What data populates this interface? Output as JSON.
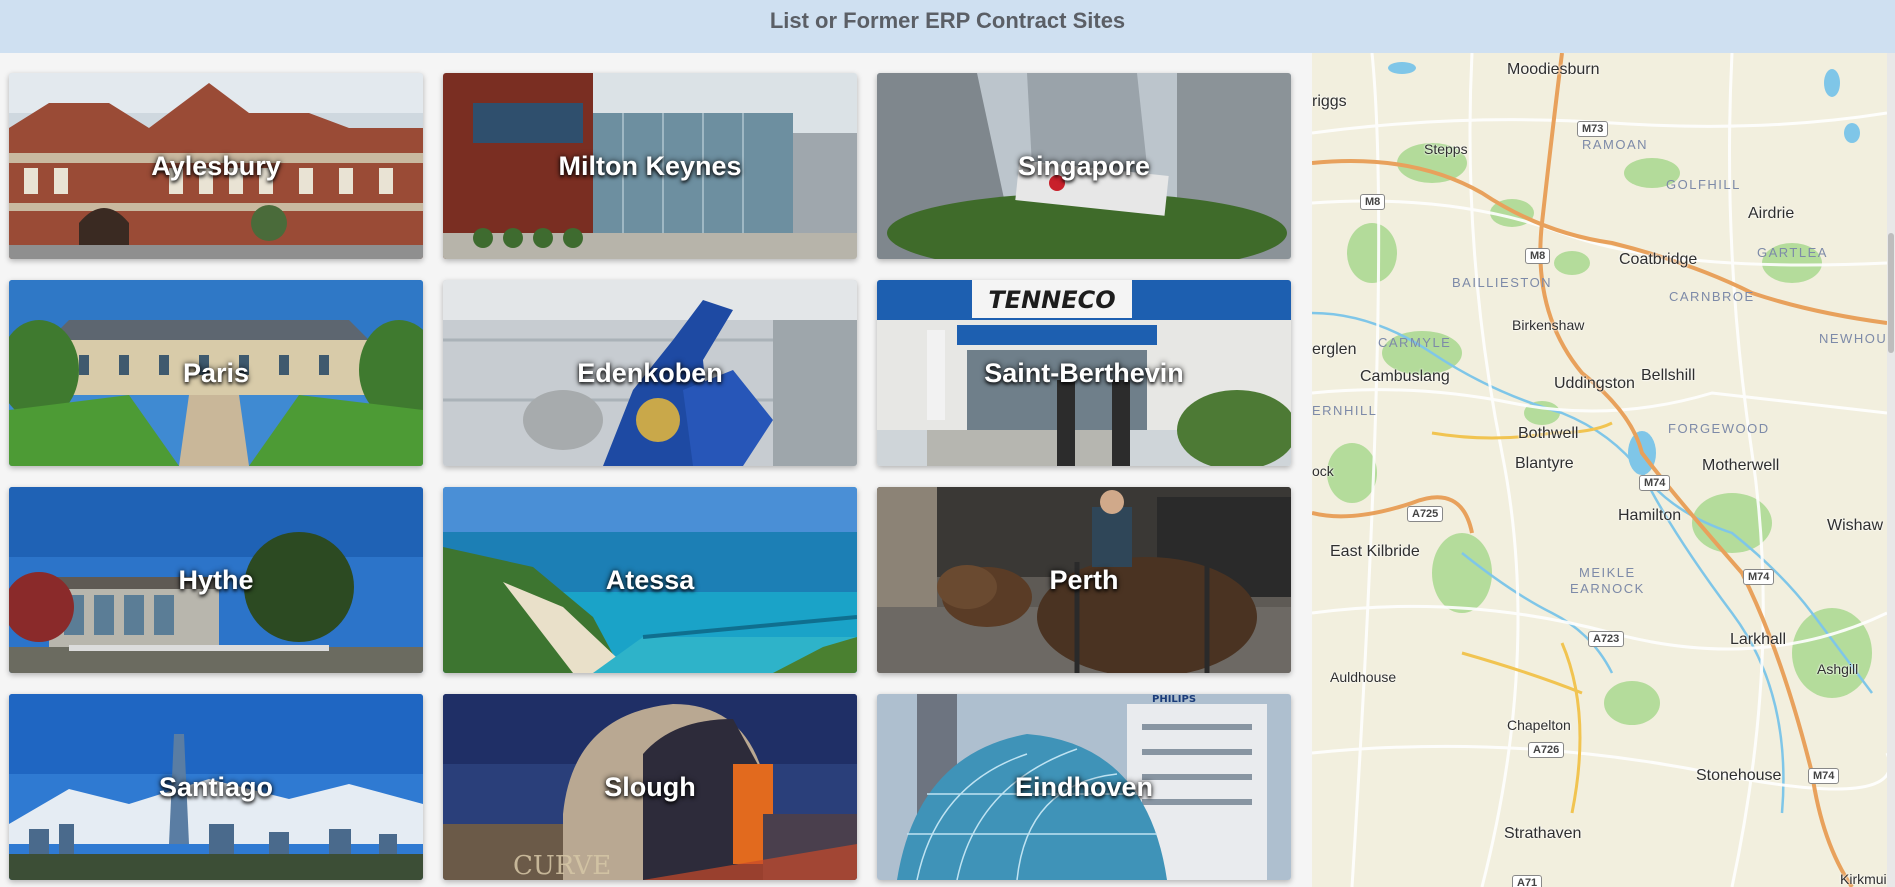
{
  "header": {
    "title": "List or Former ERP Contract Sites"
  },
  "sites": [
    {
      "label": "Aylesbury"
    },
    {
      "label": "Milton Keynes"
    },
    {
      "label": "Singapore"
    },
    {
      "label": "Paris"
    },
    {
      "label": "Edenkoben"
    },
    {
      "label": "Saint-Berthevin"
    },
    {
      "label": "Hythe"
    },
    {
      "label": "Atessa"
    },
    {
      "label": "Perth"
    },
    {
      "label": "Santiago"
    },
    {
      "label": "Slough"
    },
    {
      "label": "Eindhoven"
    }
  ],
  "map": {
    "towns": [
      "Moodiesburn",
      "riggs",
      "Stepps",
      "Airdrie",
      "Coatbridge",
      "Birkenshaw",
      "erglen",
      "Cambuslang",
      "Uddingston",
      "Bellshill",
      "Bothwell",
      "Blantyre",
      "Motherwell",
      "ock",
      "Hamilton",
      "Wishaw",
      "East Kilbride",
      "Larkhall",
      "Ashgill",
      "Auldhouse",
      "Chapelton",
      "Stonehouse",
      "Strathaven",
      "Kirkmui"
    ],
    "districts": [
      "RAMOAN",
      "GOLFHILL",
      "GARTLEA",
      "BAILLIESTON",
      "CARNBROE",
      "NEWHOUS",
      "CARMYLE",
      "ERNHILL",
      "FORGEWOOD",
      "MEIKLE",
      "EARNOCK"
    ],
    "roads": [
      "M73",
      "M8",
      "M8",
      "M74",
      "A725",
      "M74",
      "A723",
      "A726",
      "M74",
      "A71"
    ],
    "colors": {
      "land": "#f2efde",
      "park": "#a9d88f",
      "water": "#7fc6e8",
      "motorway": "#e8a15c",
      "road": "#ffffff"
    }
  }
}
